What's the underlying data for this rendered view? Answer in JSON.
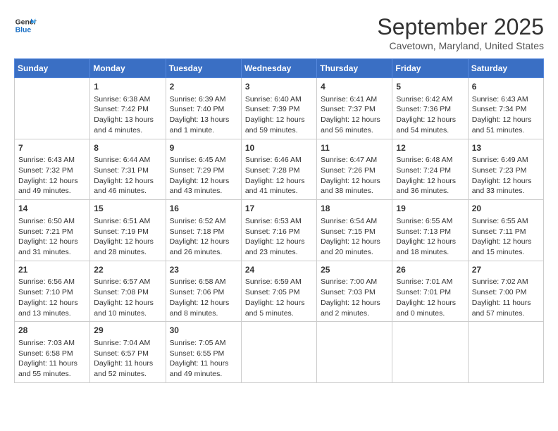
{
  "logo": {
    "line1": "General",
    "line2": "Blue"
  },
  "title": "September 2025",
  "subtitle": "Cavetown, Maryland, United States",
  "days_of_week": [
    "Sunday",
    "Monday",
    "Tuesday",
    "Wednesday",
    "Thursday",
    "Friday",
    "Saturday"
  ],
  "weeks": [
    [
      {
        "day": "",
        "info": ""
      },
      {
        "day": "1",
        "info": "Sunrise: 6:38 AM\nSunset: 7:42 PM\nDaylight: 13 hours\nand 4 minutes."
      },
      {
        "day": "2",
        "info": "Sunrise: 6:39 AM\nSunset: 7:40 PM\nDaylight: 13 hours\nand 1 minute."
      },
      {
        "day": "3",
        "info": "Sunrise: 6:40 AM\nSunset: 7:39 PM\nDaylight: 12 hours\nand 59 minutes."
      },
      {
        "day": "4",
        "info": "Sunrise: 6:41 AM\nSunset: 7:37 PM\nDaylight: 12 hours\nand 56 minutes."
      },
      {
        "day": "5",
        "info": "Sunrise: 6:42 AM\nSunset: 7:36 PM\nDaylight: 12 hours\nand 54 minutes."
      },
      {
        "day": "6",
        "info": "Sunrise: 6:43 AM\nSunset: 7:34 PM\nDaylight: 12 hours\nand 51 minutes."
      }
    ],
    [
      {
        "day": "7",
        "info": "Sunrise: 6:43 AM\nSunset: 7:32 PM\nDaylight: 12 hours\nand 49 minutes."
      },
      {
        "day": "8",
        "info": "Sunrise: 6:44 AM\nSunset: 7:31 PM\nDaylight: 12 hours\nand 46 minutes."
      },
      {
        "day": "9",
        "info": "Sunrise: 6:45 AM\nSunset: 7:29 PM\nDaylight: 12 hours\nand 43 minutes."
      },
      {
        "day": "10",
        "info": "Sunrise: 6:46 AM\nSunset: 7:28 PM\nDaylight: 12 hours\nand 41 minutes."
      },
      {
        "day": "11",
        "info": "Sunrise: 6:47 AM\nSunset: 7:26 PM\nDaylight: 12 hours\nand 38 minutes."
      },
      {
        "day": "12",
        "info": "Sunrise: 6:48 AM\nSunset: 7:24 PM\nDaylight: 12 hours\nand 36 minutes."
      },
      {
        "day": "13",
        "info": "Sunrise: 6:49 AM\nSunset: 7:23 PM\nDaylight: 12 hours\nand 33 minutes."
      }
    ],
    [
      {
        "day": "14",
        "info": "Sunrise: 6:50 AM\nSunset: 7:21 PM\nDaylight: 12 hours\nand 31 minutes."
      },
      {
        "day": "15",
        "info": "Sunrise: 6:51 AM\nSunset: 7:19 PM\nDaylight: 12 hours\nand 28 minutes."
      },
      {
        "day": "16",
        "info": "Sunrise: 6:52 AM\nSunset: 7:18 PM\nDaylight: 12 hours\nand 26 minutes."
      },
      {
        "day": "17",
        "info": "Sunrise: 6:53 AM\nSunset: 7:16 PM\nDaylight: 12 hours\nand 23 minutes."
      },
      {
        "day": "18",
        "info": "Sunrise: 6:54 AM\nSunset: 7:15 PM\nDaylight: 12 hours\nand 20 minutes."
      },
      {
        "day": "19",
        "info": "Sunrise: 6:55 AM\nSunset: 7:13 PM\nDaylight: 12 hours\nand 18 minutes."
      },
      {
        "day": "20",
        "info": "Sunrise: 6:55 AM\nSunset: 7:11 PM\nDaylight: 12 hours\nand 15 minutes."
      }
    ],
    [
      {
        "day": "21",
        "info": "Sunrise: 6:56 AM\nSunset: 7:10 PM\nDaylight: 12 hours\nand 13 minutes."
      },
      {
        "day": "22",
        "info": "Sunrise: 6:57 AM\nSunset: 7:08 PM\nDaylight: 12 hours\nand 10 minutes."
      },
      {
        "day": "23",
        "info": "Sunrise: 6:58 AM\nSunset: 7:06 PM\nDaylight: 12 hours\nand 8 minutes."
      },
      {
        "day": "24",
        "info": "Sunrise: 6:59 AM\nSunset: 7:05 PM\nDaylight: 12 hours\nand 5 minutes."
      },
      {
        "day": "25",
        "info": "Sunrise: 7:00 AM\nSunset: 7:03 PM\nDaylight: 12 hours\nand 2 minutes."
      },
      {
        "day": "26",
        "info": "Sunrise: 7:01 AM\nSunset: 7:01 PM\nDaylight: 12 hours\nand 0 minutes."
      },
      {
        "day": "27",
        "info": "Sunrise: 7:02 AM\nSunset: 7:00 PM\nDaylight: 11 hours\nand 57 minutes."
      }
    ],
    [
      {
        "day": "28",
        "info": "Sunrise: 7:03 AM\nSunset: 6:58 PM\nDaylight: 11 hours\nand 55 minutes."
      },
      {
        "day": "29",
        "info": "Sunrise: 7:04 AM\nSunset: 6:57 PM\nDaylight: 11 hours\nand 52 minutes."
      },
      {
        "day": "30",
        "info": "Sunrise: 7:05 AM\nSunset: 6:55 PM\nDaylight: 11 hours\nand 49 minutes."
      },
      {
        "day": "",
        "info": ""
      },
      {
        "day": "",
        "info": ""
      },
      {
        "day": "",
        "info": ""
      },
      {
        "day": "",
        "info": ""
      }
    ]
  ]
}
